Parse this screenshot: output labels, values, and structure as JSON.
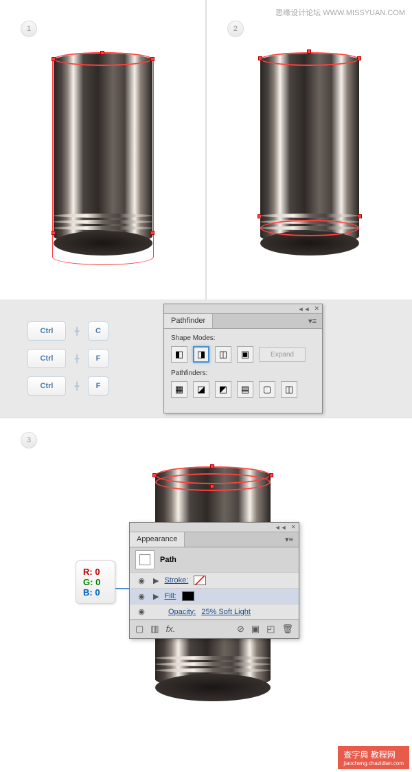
{
  "watermark": {
    "text": "思缘设计论坛 WWW.MISSYUAN.COM"
  },
  "steps": {
    "one": "1",
    "two": "2",
    "three": "3"
  },
  "shortcuts": [
    {
      "mod": "Ctrl",
      "key": "C"
    },
    {
      "mod": "Ctrl",
      "key": "F"
    },
    {
      "mod": "Ctrl",
      "key": "F"
    }
  ],
  "pathfinder": {
    "title": "Pathfinder",
    "shape_modes_label": "Shape Modes:",
    "pathfinders_label": "Pathfinders:",
    "expand_label": "Expand"
  },
  "appearance": {
    "title": "Appearance",
    "path_label": "Path",
    "stroke_label": "Stroke:",
    "fill_label": "Fill:",
    "opacity_label": "Opacity:",
    "opacity_value": "25% Soft Light",
    "fx_label": "fx."
  },
  "rgb": {
    "r_label": "R:",
    "r_val": "0",
    "g_label": "G:",
    "g_val": "0",
    "b_label": "B:",
    "b_val": "0"
  },
  "footer": {
    "main": "查字典 教程网",
    "url": "jiaocheng.chazidian.com"
  }
}
